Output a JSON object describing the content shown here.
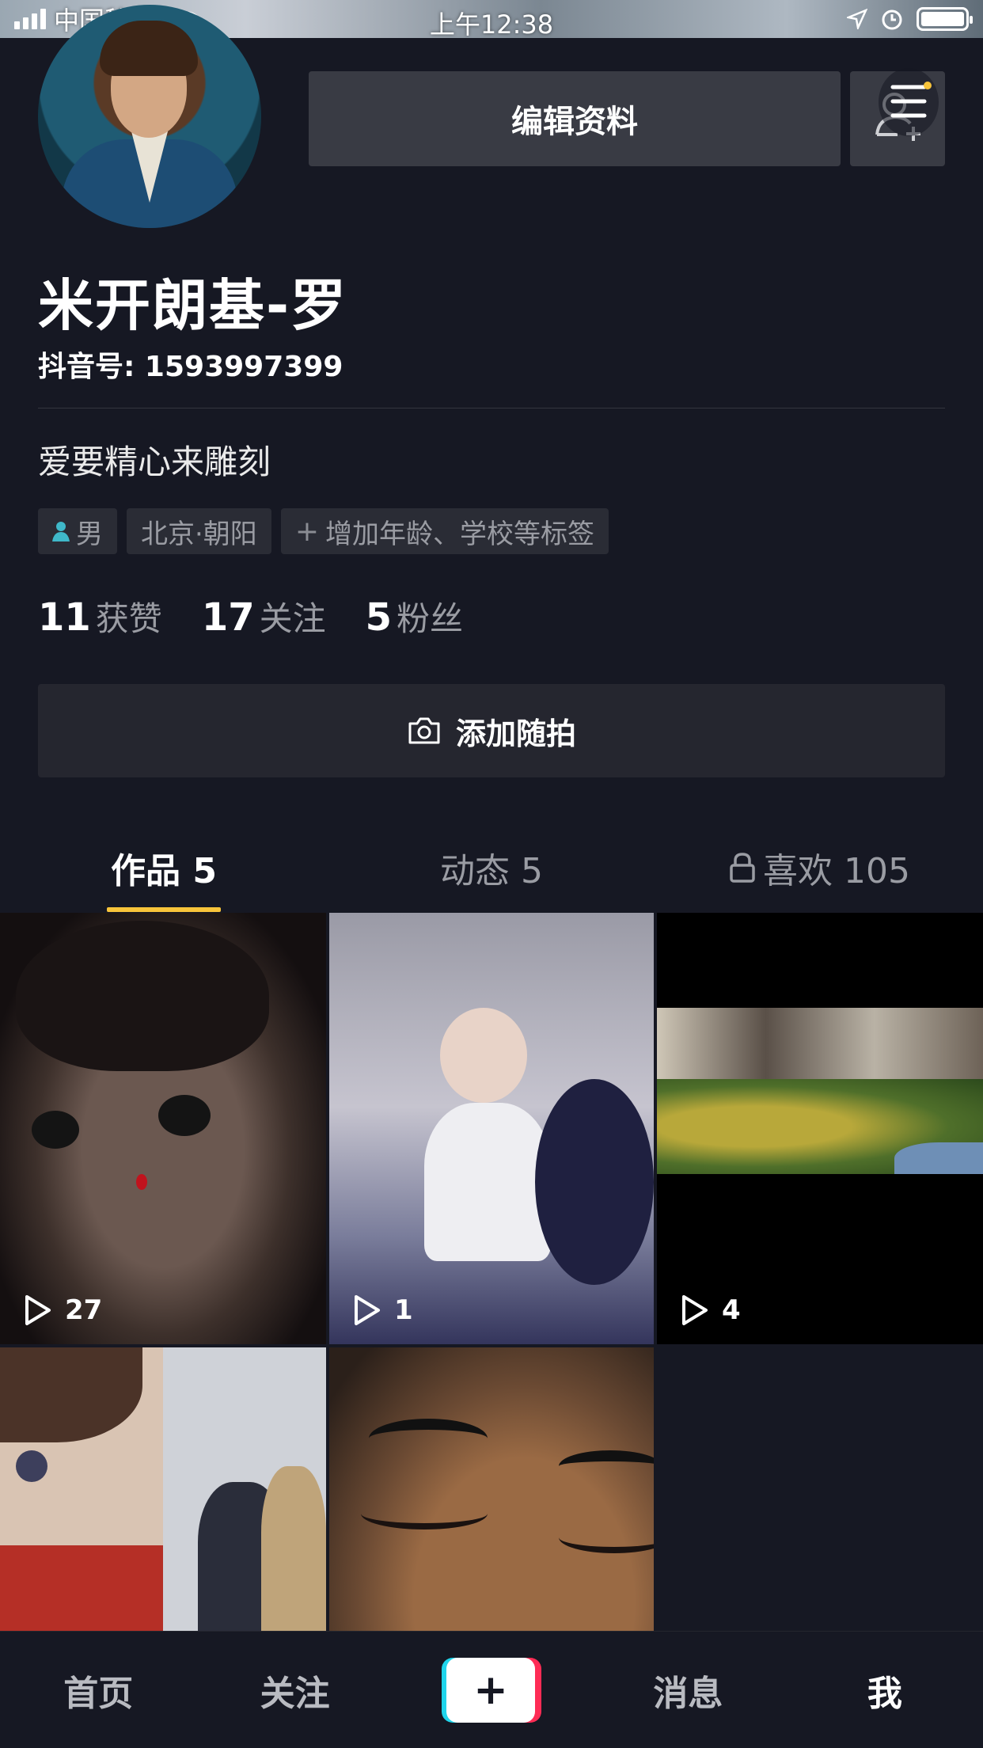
{
  "status_bar": {
    "carrier": "中国移动",
    "time": "上午12:38"
  },
  "profile": {
    "edit_label": "编辑资料",
    "username": "米开朗基-罗",
    "douyin_id": "抖音号: 1593997399",
    "bio": "爱要精心来雕刻",
    "tags": {
      "gender": "男",
      "location": "北京·朝阳",
      "add": "增加年龄、学校等标签"
    },
    "stats": [
      {
        "num": "11",
        "label": "获赞"
      },
      {
        "num": "17",
        "label": "关注"
      },
      {
        "num": "5",
        "label": "粉丝"
      }
    ],
    "snap_label": "添加随拍"
  },
  "tabs": [
    {
      "label": "作品 5"
    },
    {
      "label": "动态 5"
    },
    {
      "label": "喜欢 105"
    }
  ],
  "videos": [
    {
      "plays": "27"
    },
    {
      "plays": "1"
    },
    {
      "plays": "4"
    },
    {
      "plays": ""
    },
    {
      "plays": ""
    }
  ],
  "bottom_nav": {
    "home": "首页",
    "follow": "关注",
    "create": "+",
    "messages": "消息",
    "me": "我"
  },
  "colors": {
    "background": "#161823",
    "accent": "#f8c43a",
    "create_cyan": "#20d5ec",
    "create_red": "#fe2c55"
  }
}
